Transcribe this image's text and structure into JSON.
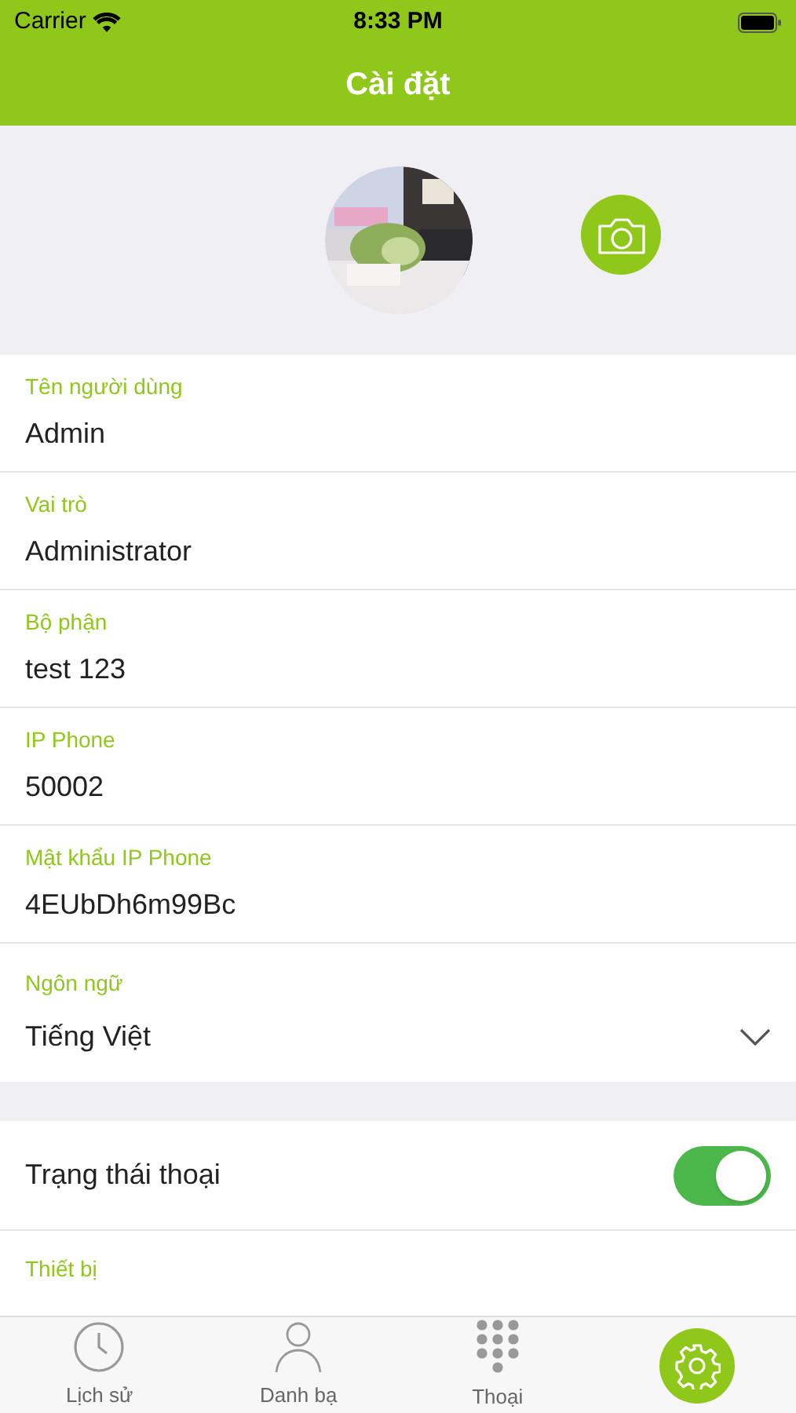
{
  "status_bar": {
    "carrier": "Carrier",
    "time": "8:33 PM"
  },
  "nav_bar": {
    "title": "Cài đặt"
  },
  "fields": [
    {
      "kind": "text",
      "label": "Tên người dùng",
      "value": "Admin"
    },
    {
      "kind": "text",
      "label": "Vai trò",
      "value": "Administrator"
    },
    {
      "kind": "text",
      "label": "Bộ phận",
      "value": "test 123"
    },
    {
      "kind": "text",
      "label": "IP Phone",
      "value": "50002"
    },
    {
      "kind": "text",
      "label": "Mật khẩu IP Phone",
      "value": "4EUbDh6m99Bc"
    },
    {
      "kind": "select",
      "label": "Ngôn ngữ",
      "value": "Tiếng Việt"
    }
  ],
  "settings": [
    {
      "kind": "toggle",
      "label": "Trạng thái thoại",
      "on": true
    },
    {
      "kind": "select",
      "label": "Thiết bị"
    }
  ],
  "tab_bar": [
    {
      "label": "Lịch sử",
      "selected": false
    },
    {
      "label": "Danh bạ",
      "selected": false
    },
    {
      "label": "Thoại",
      "selected": false
    },
    {
      "selected": true
    }
  ]
}
